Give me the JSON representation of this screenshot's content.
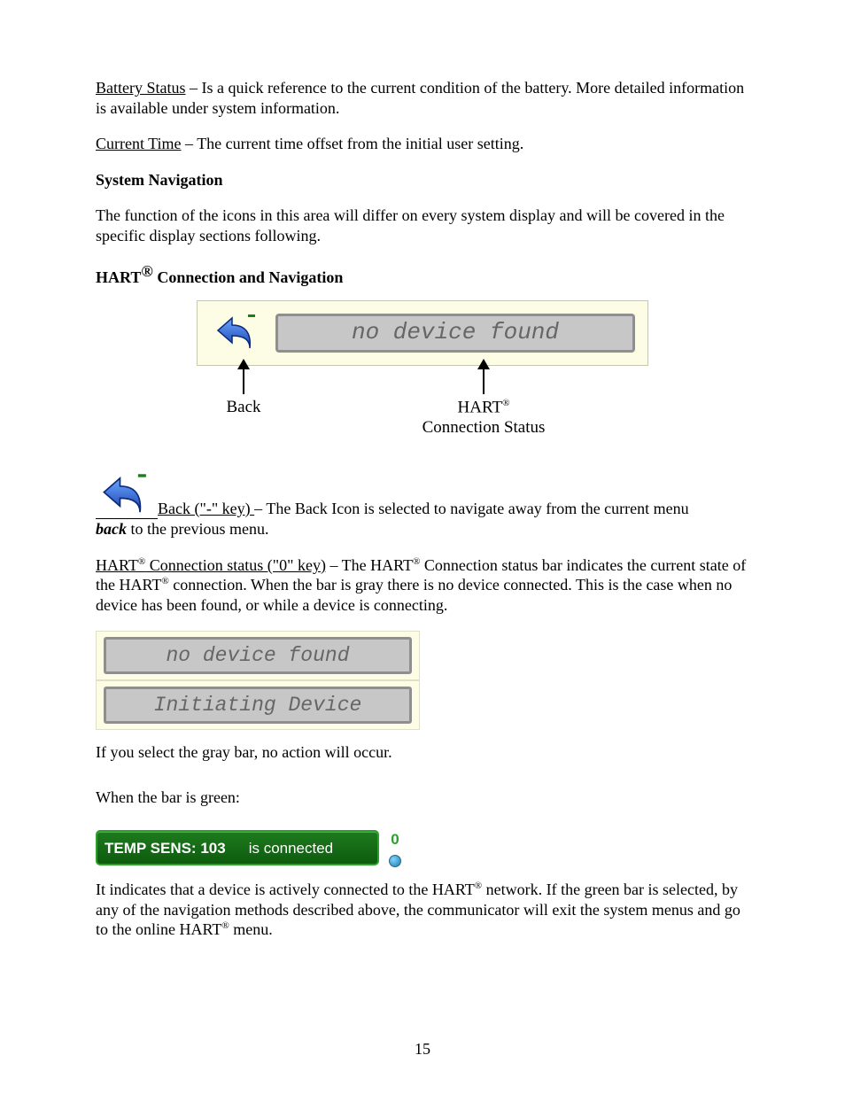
{
  "defs": {
    "battery_status_label": "Battery Status",
    "battery_status_text": " – Is a quick reference to the current condition of the battery.  More detailed information is available under system information.",
    "current_time_label": "Current Time",
    "current_time_text": " – The current time offset from the initial user setting."
  },
  "headings": {
    "system_navigation": "System Navigation",
    "hart_connection_pre": "HART",
    "hart_connection_sup": "®",
    "hart_connection_post": " Connection and Navigation"
  },
  "sys_nav_para": "The function of the icons in this area will differ on every system display and will be covered in the specific display sections following.",
  "figure1": {
    "status_text": "no device found",
    "back_label": "Back",
    "status_label_pre": "HART",
    "status_label_sup": "®",
    "status_label_post": "Connection Status"
  },
  "back_def": {
    "label": "Back (\"-\" key) ",
    "text1": " – The Back Icon is selected to navigate away from the current menu ",
    "bolditalic": "back",
    "text2": " to the previous menu."
  },
  "hart_status_def": {
    "label_pre": "HART",
    "label_sup": "®",
    "label_post": " Connection status (\"0\" key)",
    "text_a": " – The HART",
    "text_a_sup": "®",
    "text_b": " Connection status bar indicates the current state of the HART",
    "text_b_sup": "®",
    "text_c": " connection.  When the bar is gray there is no device connected.  This is the case when no device has been found, or while a device is connecting."
  },
  "gray_bars": {
    "bar1": "no device found",
    "bar2": "Initiating Device"
  },
  "gray_bar_note": "If you select the gray bar, no action will occur.",
  "green_intro": "When the bar is green:",
  "green_bar": {
    "device": "TEMP SENS: 103",
    "status": "is connected",
    "address": "0"
  },
  "green_para": {
    "t1": "It indicates that a device is actively connected to the HART",
    "sup1": "®",
    "t2": " network.  If the green bar is selected, by any of the navigation methods described above, the communicator will exit the system menus and go to the online HART",
    "sup2": "®",
    "t3": " menu."
  },
  "page_number": "15"
}
